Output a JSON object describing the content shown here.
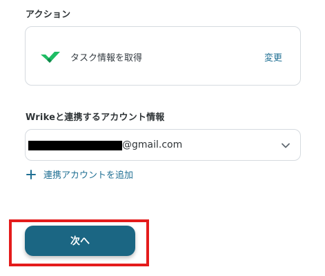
{
  "action": {
    "section_label": "アクション",
    "name": "タスク情報を取得",
    "change_label": "変更",
    "logo_icon": "wrike-check-icon",
    "logo_color": "#1fbd64"
  },
  "account": {
    "section_label": "Wrikeと連携するアカウント情報",
    "selected_value": "@gmail.com",
    "add_label": "連携アカウントを追加"
  },
  "footer": {
    "next_label": "次へ"
  },
  "colors": {
    "accent": "#1b6683",
    "link": "#1f6f93",
    "highlight": "#e41b1b"
  }
}
